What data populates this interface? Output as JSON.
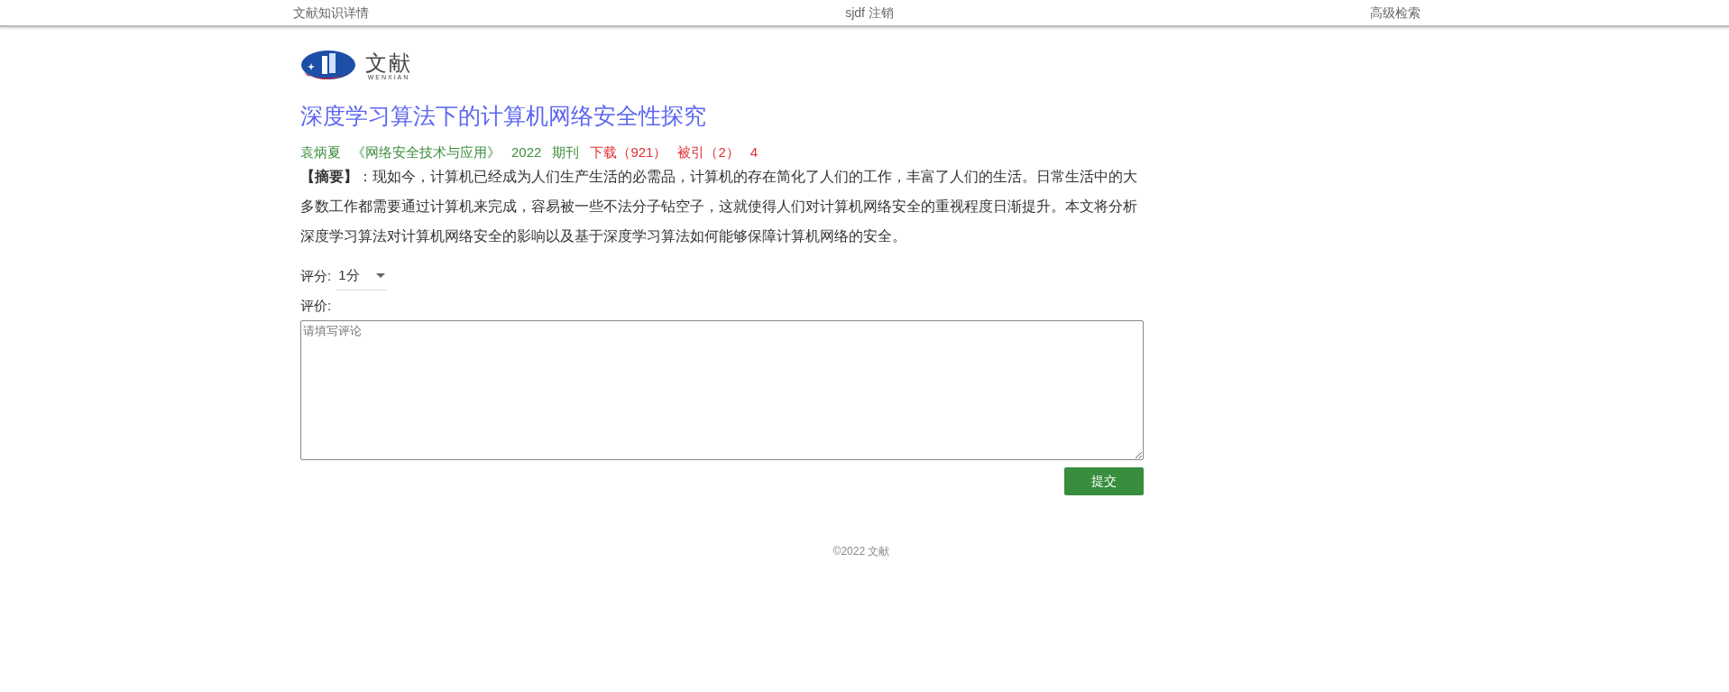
{
  "nav": {
    "items": [
      "文献知识详情",
      "sjdf 注销",
      "高级检索"
    ]
  },
  "logo": {
    "name": "文献",
    "subtitle": "WENXIAN"
  },
  "title": "深度学习算法下的计算机网络安全性探究",
  "meta": [
    {
      "text": "袁炳夏",
      "color": "#3f8f3f"
    },
    {
      "text": "《网络安全技术与应用》",
      "color": "#3f8f3f"
    },
    {
      "text": "2022",
      "color": "#3f8f3f"
    },
    {
      "text": "期刊",
      "color": "#3f8f3f"
    },
    {
      "text": "下载（921）",
      "color": "#e03131"
    },
    {
      "text": "被引（2）",
      "color": "#e03131"
    },
    {
      "text": "4",
      "color": "#e03131"
    }
  ],
  "abstract": "**【摘要】**：现如今，计算机已经成为人们生产生活的必需品，计算机的存在简化了人们的工作，丰富了人们的生活。日常生活中的大多数工作都需要通过计算机来完成，容易被一些不法分子钻空子，这就使得人们对计算机网络安全的重视程度日渐提升。本文将分析深度学习算法对计算机网络安全的影响以及基于深度学习算法如何能够保障计算机网络的安全。",
  "rating": {
    "label": "评分:",
    "value": "1分"
  },
  "review": {
    "label": "评价:",
    "placeholder": "请填写评论"
  },
  "submit": "提交",
  "footer": "©2022 文献"
}
